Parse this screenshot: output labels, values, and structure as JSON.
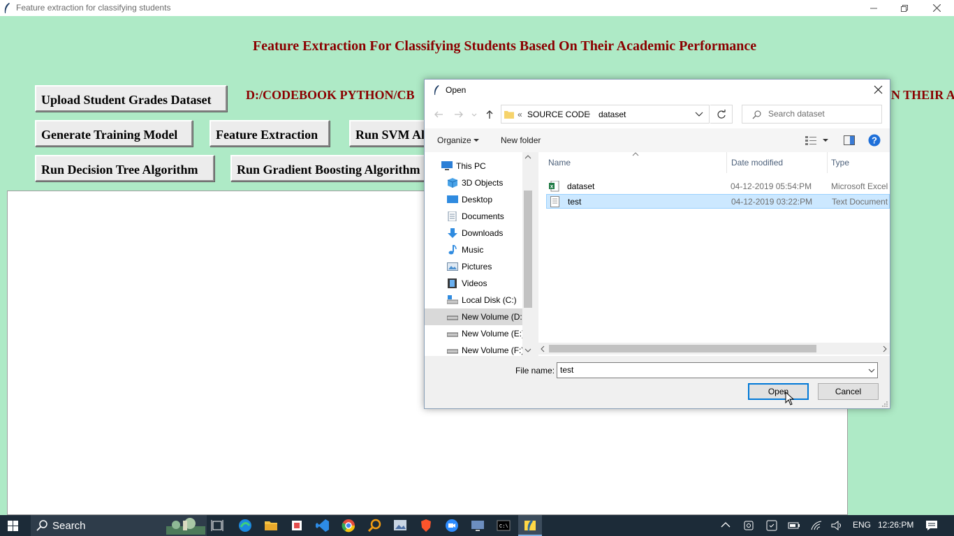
{
  "app": {
    "title": "Feature extraction for classifying students",
    "heading": "Feature Extraction For Classifying Students Based On Their Academic Performance",
    "buttons": {
      "upload": "Upload Student Grades Dataset",
      "generate": "Generate Training Model",
      "feature": "Feature Extraction",
      "svm": "Run SVM Algorithm",
      "decision_tree": "Run Decision Tree Algorithm",
      "gradient": "Run Gradient Boosting Algorithm"
    },
    "path_label": "D:/CODEBOOK PYTHON/CB",
    "path_label_right": "N THEIR AC"
  },
  "dialog": {
    "title": "Open",
    "breadcrumb": [
      "SOURCE CODE",
      "dataset"
    ],
    "breadcrumb_prefix": "«",
    "search_placeholder": "Search dataset",
    "organize": "Organize",
    "new_folder": "New folder",
    "nav_items": [
      {
        "label": "This PC",
        "icon": "computer-icon"
      },
      {
        "label": "3D Objects",
        "icon": "cube-icon"
      },
      {
        "label": "Desktop",
        "icon": "desktop-icon"
      },
      {
        "label": "Documents",
        "icon": "documents-icon"
      },
      {
        "label": "Downloads",
        "icon": "download-arrow-icon"
      },
      {
        "label": "Music",
        "icon": "music-note-icon"
      },
      {
        "label": "Pictures",
        "icon": "pictures-icon"
      },
      {
        "label": "Videos",
        "icon": "film-icon"
      },
      {
        "label": "Local Disk (C:)",
        "icon": "local-disk-icon"
      },
      {
        "label": "New Volume (D:",
        "icon": "drive-icon",
        "selected": true
      },
      {
        "label": "New Volume (E:)",
        "icon": "drive-icon"
      },
      {
        "label": "New Volume (F:)",
        "icon": "drive-icon"
      }
    ],
    "columns": {
      "name": "Name",
      "date": "Date modified",
      "type": "Type"
    },
    "files": [
      {
        "name": "dataset",
        "date": "04-12-2019 05:54:PM",
        "type": "Microsoft Excel",
        "icon": "excel-file-icon"
      },
      {
        "name": "test",
        "date": "04-12-2019 03:22:PM",
        "type": "Text Document",
        "icon": "text-file-icon",
        "selected": true
      }
    ],
    "filename_label": "File name:",
    "filename_value": "test",
    "open_label": "Open",
    "cancel_label": "Cancel"
  },
  "taskbar": {
    "search_text": "Search",
    "language": "ENG",
    "time": "12:26:PM"
  },
  "colors": {
    "app_bg": "#aeeac6",
    "heading": "#8b0000",
    "selection": "#cce8ff",
    "taskbar": "#1c2b38"
  }
}
